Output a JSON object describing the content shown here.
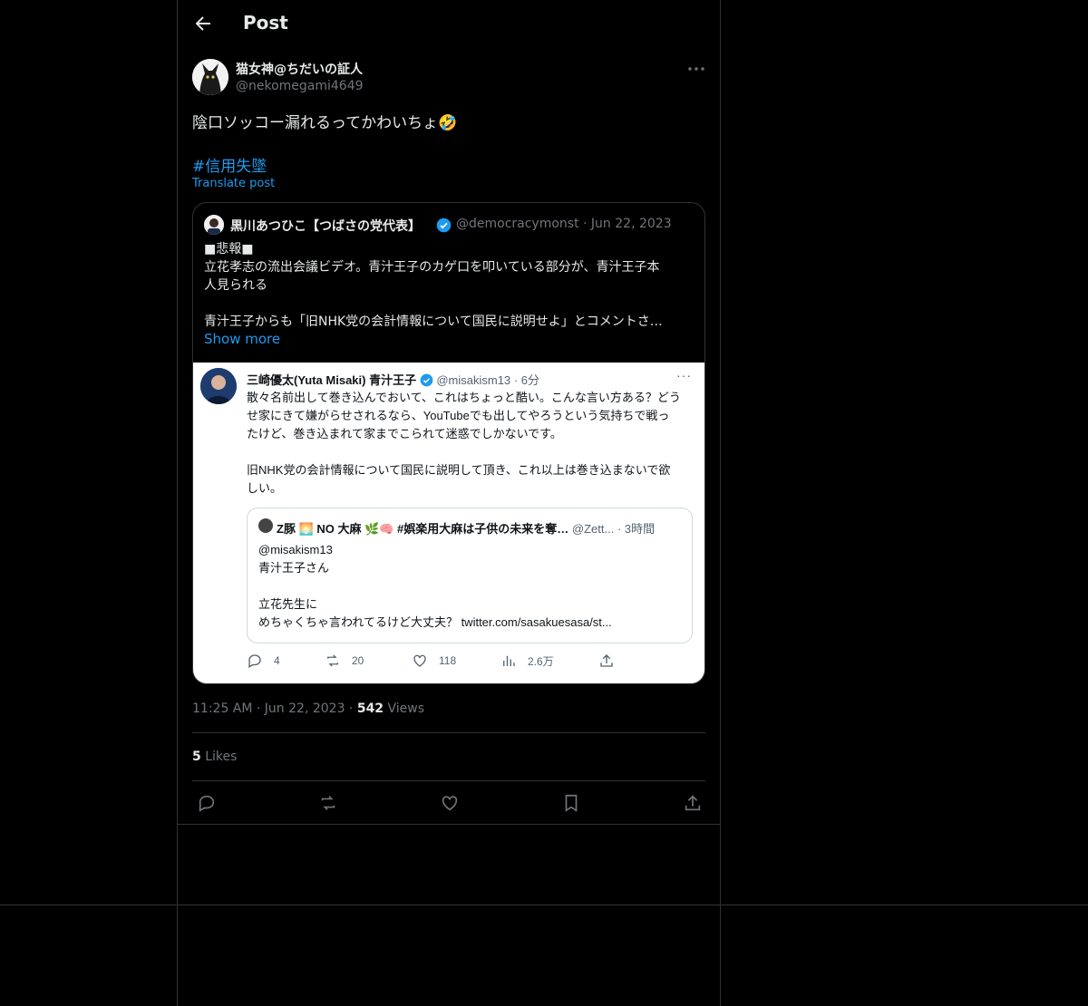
{
  "header": {
    "title": "Post"
  },
  "post": {
    "display_name": "猫女神@ちだいの証人",
    "handle": "@nekomegami4649",
    "text": "陰口ソッコー漏れるってかわいちょ🤣",
    "hashtag": "#信用失墜",
    "translate": "Translate post",
    "timestamp": "11:25 AM · Jun 22, 2023 · ",
    "views_count": "542",
    "views_label": " Views",
    "likes_count": "5",
    "likes_label": " Likes"
  },
  "quote": {
    "display_name": "黒川あつひこ【つばさの党代表】",
    "meta": "@democracymonst · Jun 22, 2023",
    "lines": [
      "■悲報■",
      "立花孝志の流出会議ビデオ。青汁王子のカゲ口を叩いている部分が、青汁王子本",
      "人見られる",
      "",
      "青汁王子からも「旧NHK党の会計情報について国民に説明せよ」とコメントさ…"
    ],
    "show_more": "Show more",
    "image": {
      "name": "三崎優太(Yuta Misaki) 青汁王子",
      "meta": "@misakism13 · 6分",
      "dots": "···",
      "lines": [
        "散々名前出して巻き込んでおいて、これはちょっと酷い。こんな言い方ある？どう",
        "せ家にきて嫌がらせされるなら、YouTubeでも出してやろうという気持ちで戦っ",
        "たけど、巻き込まれて家までこられて迷惑でしかないです。",
        "",
        "旧NHK党の会計情報について国民に説明して頂き、これ以上は巻き込まないで欲",
        "しい。"
      ],
      "nested": {
        "name": "Z豚 🌅 NO 大麻 🌿🧠 #娯楽用大麻は子供の未来を奪…",
        "meta": " @Zett... · 3時間",
        "lines": [
          "@misakism13",
          "青汁王子さん",
          "",
          "立花先生に",
          "めちゃくちゃ言われてるけど大丈夫？ twitter.com/sasakuesasa/st..."
        ]
      },
      "actions": {
        "replies": "4",
        "reposts": "20",
        "likes": "118",
        "views": "2.6万"
      }
    }
  },
  "colors": {
    "accent": "#1d9bf0",
    "background": "#000000",
    "border": "#2f3336",
    "muted": "#71767b"
  },
  "icons": [
    "back-arrow-icon",
    "more-icon",
    "verified-icon",
    "reply-icon",
    "repost-icon",
    "like-icon",
    "bookmark-icon",
    "share-icon",
    "views-icon"
  ]
}
